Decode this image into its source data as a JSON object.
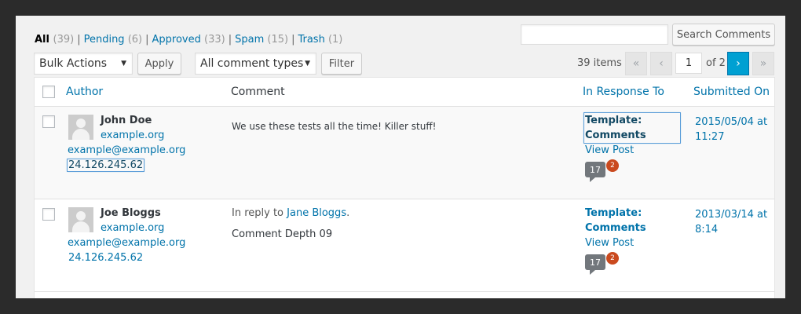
{
  "filters": {
    "all": {
      "label": "All",
      "count": "(39)"
    },
    "pending": {
      "label": "Pending",
      "count": "(6)"
    },
    "approved": {
      "label": "Approved",
      "count": "(33)"
    },
    "spam": {
      "label": "Spam",
      "count": "(15)"
    },
    "trash": {
      "label": "Trash",
      "count": "(1)"
    },
    "separator": "|"
  },
  "search": {
    "value": "",
    "button_label": "Search Comments"
  },
  "bulk_actions": {
    "selected": "Bulk Actions",
    "apply_label": "Apply"
  },
  "comment_type": {
    "selected": "All comment types",
    "filter_label": "Filter"
  },
  "pagination": {
    "items": "39 items",
    "first": "«",
    "prev": "‹",
    "current_page": "1",
    "of_total": "of 2",
    "next": "›",
    "last": "»"
  },
  "columns": {
    "author": "Author",
    "comment": "Comment",
    "response": "In Response To",
    "submitted": "Submitted On"
  },
  "rows": [
    {
      "author_name": "John Doe",
      "author_url": "example.org",
      "author_email": "example@example.org",
      "author_ip": "24.126.245.62",
      "comment": "We use these tests all the time! Killer stuff!",
      "response_title": "Template: Comments",
      "view_post": "View Post",
      "comment_count": "17",
      "pending_count": "2",
      "submitted": "2015/05/04 at 11:27"
    },
    {
      "author_name": "Joe Bloggs",
      "author_url": "example.org",
      "author_email": "example@example.org",
      "author_ip": "24.126.245.62",
      "reply_prefix": "In reply to",
      "reply_name": "Jane Bloggs",
      "reply_suffix": ".",
      "comment": "Comment Depth 09",
      "response_title": "Template: Comments",
      "view_post": "View Post",
      "comment_count": "17",
      "pending_count": "2",
      "submitted": "2013/03/14 at 8:14"
    }
  ],
  "colors": {
    "link": "#0073aa",
    "primary_button": "#00a0d2",
    "pending_badge": "#ca4a1f",
    "comment_bubble": "#72777c",
    "outer_background": "#2b2b2b"
  },
  "icons": {
    "dropdown": "triangle-down",
    "avatar": "mystery-person",
    "comment_count": "speech-bubble"
  }
}
